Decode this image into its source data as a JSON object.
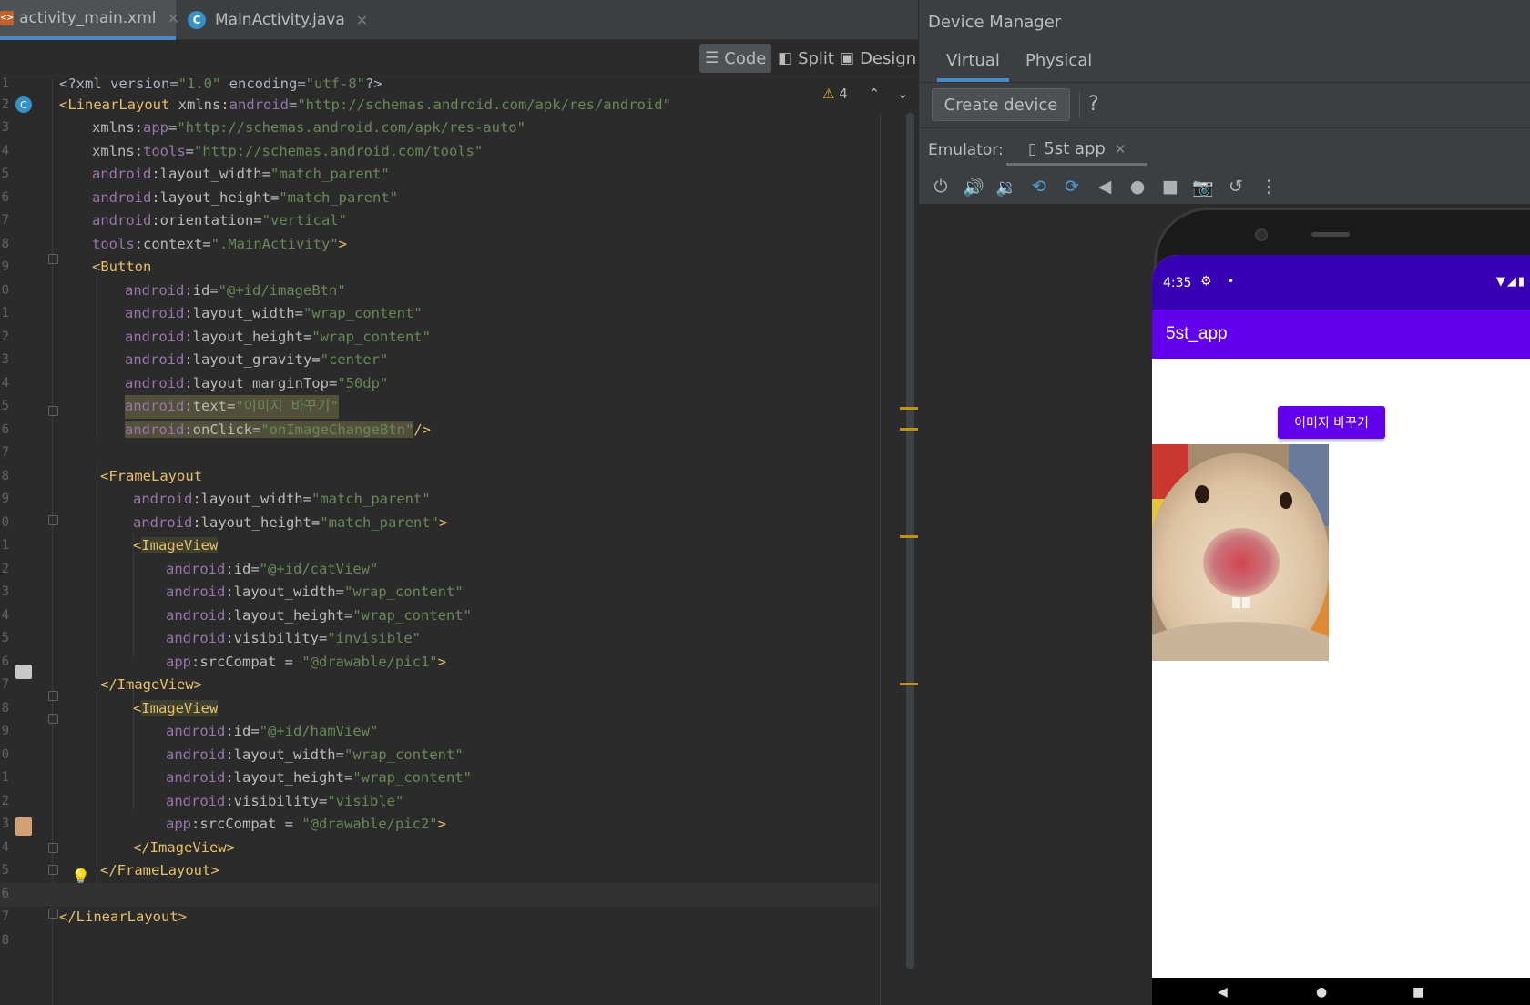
{
  "editor": {
    "tabs": [
      {
        "label": "activity_main.xml",
        "active": true
      },
      {
        "label": "MainActivity.java",
        "active": false
      }
    ],
    "modes": {
      "code": "Code",
      "split": "Split",
      "design": "Design"
    },
    "warning_count": "4",
    "lines": [
      {
        "n": "1"
      },
      {
        "n": "2"
      },
      {
        "n": "3"
      },
      {
        "n": "4"
      },
      {
        "n": "5"
      },
      {
        "n": "6"
      },
      {
        "n": "7"
      },
      {
        "n": "8"
      },
      {
        "n": "9"
      },
      {
        "n": "0"
      },
      {
        "n": "1"
      },
      {
        "n": "2"
      },
      {
        "n": "3"
      },
      {
        "n": "4"
      },
      {
        "n": "5"
      },
      {
        "n": "6"
      },
      {
        "n": "7"
      },
      {
        "n": "8"
      },
      {
        "n": "9"
      },
      {
        "n": "0"
      },
      {
        "n": "1"
      },
      {
        "n": "2"
      },
      {
        "n": "3"
      },
      {
        "n": "4"
      },
      {
        "n": "5"
      },
      {
        "n": "6"
      },
      {
        "n": "7"
      },
      {
        "n": "8"
      },
      {
        "n": "9"
      },
      {
        "n": "0"
      },
      {
        "n": "1"
      },
      {
        "n": "2"
      },
      {
        "n": "3"
      },
      {
        "n": "4"
      },
      {
        "n": "5"
      },
      {
        "n": "6"
      },
      {
        "n": "7"
      },
      {
        "n": "8"
      }
    ],
    "code": {
      "l1": [
        "<?xml version=",
        "\"1.0\"",
        " encoding=",
        "\"utf-8\"",
        "?>"
      ],
      "l2": [
        "<LinearLayout",
        " xmlns:",
        "android",
        "=",
        "\"http://schemas.android.com/apk/res/android\""
      ],
      "l3": [
        "xmlns:",
        "app",
        "=",
        "\"http://schemas.android.com/apk/res-auto\""
      ],
      "l4": [
        "xmlns:",
        "tools",
        "=",
        "\"http://schemas.android.com/tools\""
      ],
      "l5": [
        "android",
        ":layout_width",
        "=",
        "\"match_parent\""
      ],
      "l6": [
        "android",
        ":layout_height",
        "=",
        "\"match_parent\""
      ],
      "l7": [
        "android",
        ":orientation",
        "=",
        "\"vertical\""
      ],
      "l8": [
        "tools",
        ":context",
        "=",
        "\".MainActivity\"",
        ">"
      ],
      "l9": [
        "<Button"
      ],
      "l10": [
        "android",
        ":id",
        "=",
        "\"@+id/imageBtn\""
      ],
      "l11": [
        "android",
        ":layout_width",
        "=",
        "\"wrap_content\""
      ],
      "l12": [
        "android",
        ":layout_height",
        "=",
        "\"wrap_content\""
      ],
      "l13": [
        "android",
        ":layout_gravity",
        "=",
        "\"center\""
      ],
      "l14": [
        "android",
        ":layout_marginTop",
        "=",
        "\"50dp\""
      ],
      "l15": [
        "android",
        ":text",
        "=",
        "\"이미지 바꾸기\""
      ],
      "l16": [
        "android",
        ":onClick",
        "=",
        "\"onImageChangeBtn\"",
        "/>"
      ],
      "l18": [
        "<FrameLayout"
      ],
      "l19": [
        "android",
        ":layout_width",
        "=",
        "\"match_parent\""
      ],
      "l20": [
        "android",
        ":layout_height",
        "=",
        "\"match_parent\"",
        ">"
      ],
      "l21": [
        "<",
        "ImageView"
      ],
      "l22": [
        "android",
        ":id",
        "=",
        "\"@+id/catView\""
      ],
      "l23": [
        "android",
        ":layout_width",
        "=",
        "\"wrap_content\""
      ],
      "l24": [
        "android",
        ":layout_height",
        "=",
        "\"wrap_content\""
      ],
      "l25": [
        "android",
        ":visibility",
        "=",
        "\"invisible\""
      ],
      "l26": [
        "app",
        ":srcCompat",
        " = ",
        "\"@drawable/pic1\"",
        ">"
      ],
      "l27": [
        "</ImageView>"
      ],
      "l28": [
        "<",
        "ImageView"
      ],
      "l29": [
        "android",
        ":id",
        "=",
        "\"@+id/hamView\""
      ],
      "l30": [
        "android",
        ":layout_width",
        "=",
        "\"wrap_content\""
      ],
      "l31": [
        "android",
        ":layout_height",
        "=",
        "\"wrap_content\""
      ],
      "l32": [
        "android",
        ":visibility",
        "=",
        "\"visible\""
      ],
      "l33": [
        "app",
        ":srcCompat",
        " = ",
        "\"@drawable/pic2\"",
        ">"
      ],
      "l34": [
        "</ImageView>"
      ],
      "l35": [
        "</FrameLayout>"
      ],
      "l37": [
        "</LinearLayout>"
      ]
    }
  },
  "device_manager": {
    "title": "Device Manager",
    "tabs": [
      "Virtual",
      "Physical"
    ],
    "create_device": "Create device",
    "help": "?",
    "emulator_label": "Emulator:",
    "emulator_tab": "5st app"
  },
  "emulator_screen": {
    "time": "4:35",
    "app_title": "5st_app",
    "button_label": "이미지 바꾸기",
    "colors": {
      "status_bar": "#3700b3",
      "app_bar": "#6200ee",
      "button": "#6200ee"
    }
  }
}
